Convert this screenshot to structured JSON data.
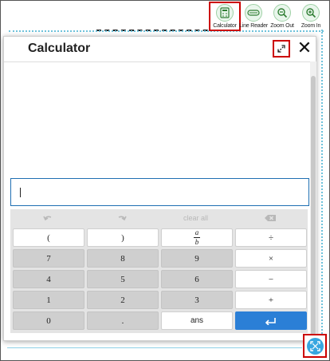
{
  "toolbar": {
    "items": [
      {
        "label": "Calculator",
        "icon": "calculator-icon"
      },
      {
        "label": "Line Reader",
        "icon": "line-reader-icon"
      },
      {
        "label": "Zoom Out",
        "icon": "zoom-out-icon"
      },
      {
        "label": "Zoom In",
        "icon": "zoom-in-icon"
      }
    ]
  },
  "dialog": {
    "title": "Calculator",
    "close_glyph": "✕",
    "display_value": ""
  },
  "keypad": {
    "controls": [
      "undo",
      "redo",
      "clear all",
      "backspace"
    ],
    "clear_all_label": "clear all",
    "rows": [
      [
        "(",
        ")",
        "a/b",
        "÷"
      ],
      [
        "7",
        "8",
        "9",
        "×"
      ],
      [
        "4",
        "5",
        "6",
        "−"
      ],
      [
        "1",
        "2",
        "3",
        "+"
      ],
      [
        "0",
        ".",
        "ans",
        "enter"
      ]
    ],
    "labels": {
      "open_paren": "(",
      "close_paren": ")",
      "frac_num": "a",
      "frac_den": "b",
      "divide": "÷",
      "k7": "7",
      "k8": "8",
      "k9": "9",
      "multiply": "×",
      "k4": "4",
      "k5": "5",
      "k6": "6",
      "minus": "−",
      "k1": "1",
      "k2": "2",
      "k3": "3",
      "plus": "+",
      "k0": "0",
      "dot": ".",
      "ans": "ans"
    }
  },
  "colors": {
    "accent": "#2b7fd6",
    "highlight_border": "#cc0000",
    "key_gray": "#cfcfcf",
    "corner_button": "#37a6e0"
  }
}
